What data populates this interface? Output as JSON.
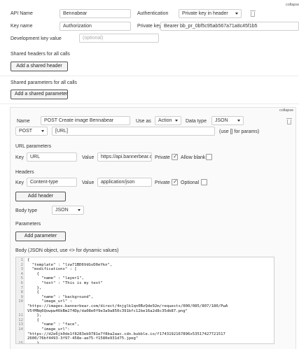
{
  "collapse_label": "collapse",
  "api": {
    "api_name_label": "API Name",
    "api_name_value": "Bennabear",
    "authentication_label": "Authentication",
    "authentication_value": "Private key in header",
    "key_name_label": "Key name",
    "key_name_value": "Authorization",
    "private_key_label": "Private key",
    "private_key_value": "Bearer bb_pr_0bf5c95ab567a71a8c45f1b5",
    "dev_key_label": "Development key value",
    "dev_key_placeholder": "(optional)"
  },
  "shared_headers": {
    "label": "Shared headers for all calls",
    "add_button": "Add a shared header"
  },
  "shared_params": {
    "label": "Shared parameters for all calls",
    "add_button": "Add a shared parameter"
  },
  "call": {
    "collapse_label": "collapse",
    "name_label": "Name",
    "name_value": "POST Create image Bennabear",
    "use_as_label": "Use as",
    "use_as_value": "Action",
    "data_type_label": "Data type",
    "data_type_value": "JSON",
    "method_value": "POST",
    "url_value": "[URL]",
    "url_hint": "(use [] for params)",
    "url_params_label": "URL parameters",
    "url_param": {
      "key_label": "Key",
      "key_value": "URL",
      "value_label": "Value",
      "value_value": "https://api.bannerbear.com",
      "private_label": "Private",
      "private_checked": true,
      "allow_blank_label": "Allow blank",
      "allow_blank_checked": false
    },
    "headers_label": "Headers",
    "header": {
      "key_label": "Key",
      "key_value": "Content-type",
      "value_label": "Value",
      "value_value": "application/json",
      "private_label": "Private",
      "private_checked": true,
      "optional_label": "Optional",
      "optional_checked": false
    },
    "add_header_button": "Add header",
    "body_type_label": "Body type",
    "body_type_value": "JSON",
    "parameters_label": "Parameters",
    "add_parameter_button": "Add parameter",
    "body_label": "Body (JSON object, use <> for dynamic values)",
    "body_lines": [
      {
        "n": "1",
        "t": "{"
      },
      {
        "n": "2",
        "t": "  \"template\" : \"lzw71BD6VdGvD0eYkn\","
      },
      {
        "n": "3",
        "t": "  \"modifications\" : ["
      },
      {
        "n": "4",
        "t": "    {"
      },
      {
        "n": "5",
        "t": "      \"name\" : \"layer1\","
      },
      {
        "n": "6",
        "t": "      \"text\" : \"This is my text\""
      },
      {
        "n": "7",
        "t": "    },"
      },
      {
        "n": "8",
        "t": "    {"
      },
      {
        "n": "9",
        "t": "      \"name\" : \"background\","
      },
      {
        "n": "10",
        "t": "      \"image_url\" :"
      },
      {
        "n": "",
        "t": "\"https://images.bannerbear.com/direct/4njglk1qn0BzQde92m/requests/000/085/807/180/PwA"
      },
      {
        "n": "",
        "t": "V5fMNq6Qowpw46kBm274Dp/da08e0f9e3a9a850c391bfc12be16a2d8c35db87.png\""
      },
      {
        "n": "11",
        "t": "    },"
      },
      {
        "n": "12",
        "t": "    {"
      },
      {
        "n": "13",
        "t": "      \"name\" : \"face\","
      },
      {
        "n": "14",
        "t": "      \"image_url\":"
      },
      {
        "n": "",
        "t": "\"https://d2e6jk0de1f8283eb9781e7f8ba2aac.cdn.bubble.io/f1743192167896x53517427721517"
      },
      {
        "n": "",
        "t": "2600/76bf4493-3f97-458e-ae75-f1580e931d75.jpeg\""
      },
      {
        "n": "15",
        "t": "    }"
      }
    ]
  }
}
